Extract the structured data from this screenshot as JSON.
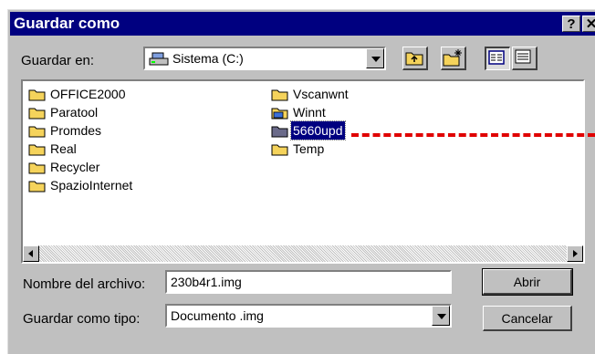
{
  "dialog": {
    "title": "Guardar como",
    "help_label": "?",
    "close_label": "✕"
  },
  "save_in": {
    "label": "Guardar en:",
    "value": "Sistema (C:)"
  },
  "files": {
    "left_column": [
      "OFFICE2000",
      "Paratool",
      "Promdes",
      "Real",
      "Recycler",
      "SpazioInternet"
    ],
    "right_column": [
      "Vscanwnt",
      "Winnt",
      "5660upd",
      "Temp"
    ],
    "selected": "5660upd"
  },
  "file_name": {
    "label": "Nombre del archivo:",
    "value": "230b4r1.img"
  },
  "file_type": {
    "label": "Guardar como tipo:",
    "value": "Documento .img"
  },
  "buttons": {
    "open": "Abrir",
    "cancel": "Cancelar"
  },
  "colors": {
    "titlebar": "#000080",
    "folder": "#f5d35b",
    "annotation": "#e00000"
  }
}
